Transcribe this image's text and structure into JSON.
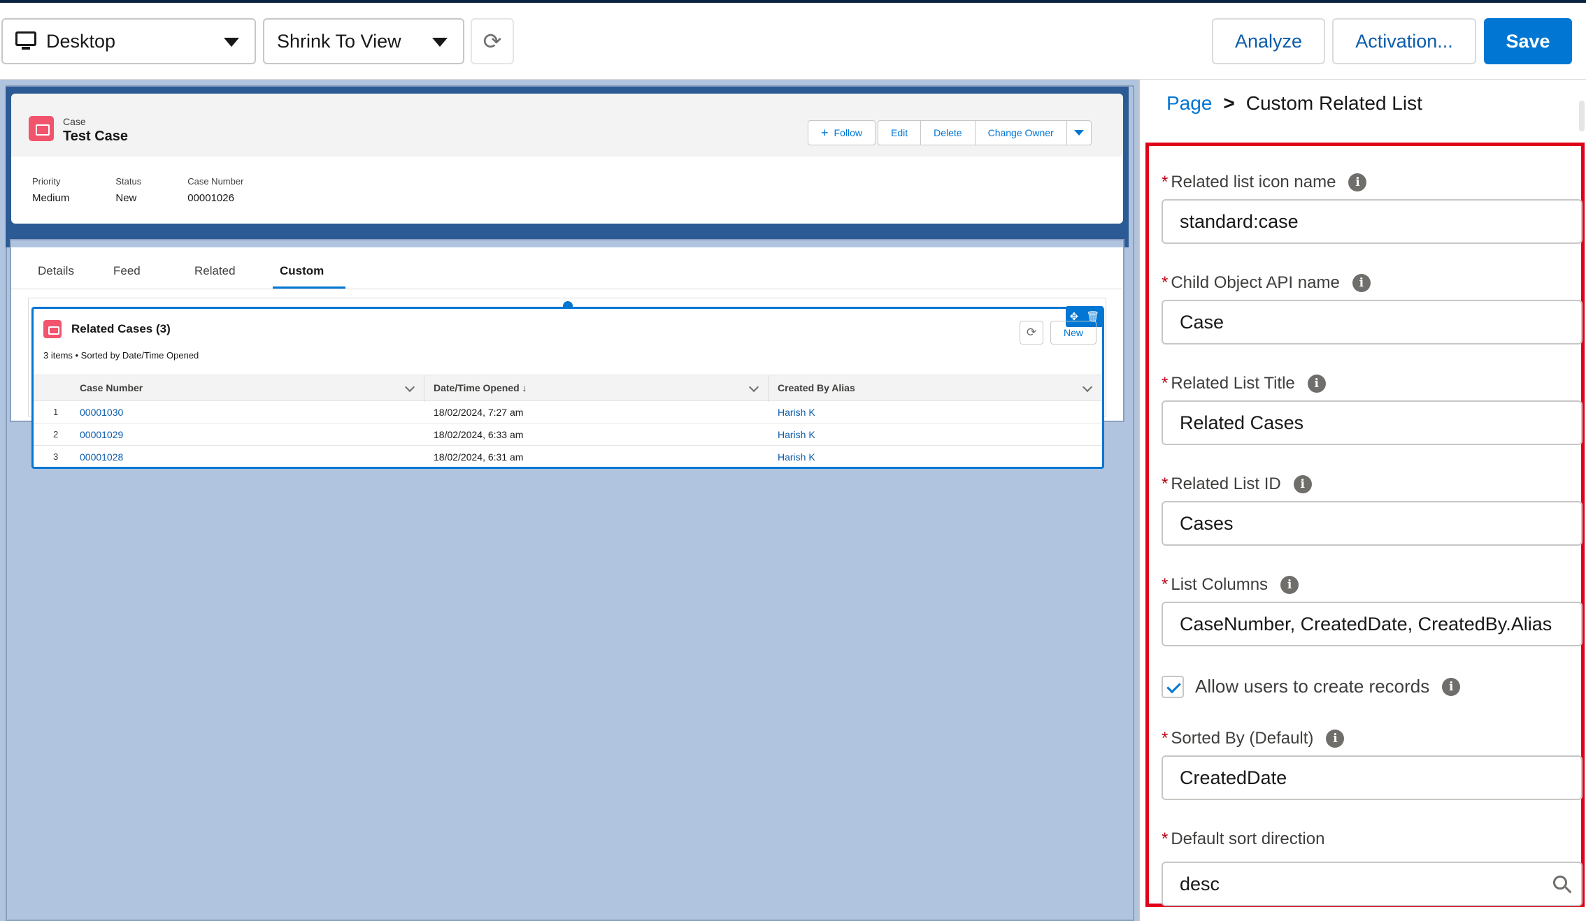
{
  "toolbar": {
    "device_label": "Desktop",
    "view_label": "Shrink To View",
    "analyze_label": "Analyze",
    "activation_label": "Activation...",
    "save_label": "Save"
  },
  "record": {
    "object_label": "Case",
    "title": "Test Case",
    "actions": {
      "follow": "Follow",
      "edit": "Edit",
      "delete": "Delete",
      "change_owner": "Change Owner"
    },
    "fields": [
      {
        "label": "Priority",
        "value": "Medium"
      },
      {
        "label": "Status",
        "value": "New"
      },
      {
        "label": "Case Number",
        "value": "00001026"
      }
    ]
  },
  "tabs": [
    "Details",
    "Feed",
    "Related",
    "Custom"
  ],
  "active_tab": "Custom",
  "related_list": {
    "title": "Related Cases (3)",
    "subtitle": "3 items • Sorted by Date/Time Opened",
    "new_label": "New",
    "columns": [
      "Case Number",
      "Date/Time Opened ↓",
      "Created By Alias"
    ],
    "rows": [
      {
        "num": "1",
        "case": "00001030",
        "opened": "18/02/2024, 7:27 am",
        "alias": "Harish K"
      },
      {
        "num": "2",
        "case": "00001029",
        "opened": "18/02/2024, 6:33 am",
        "alias": "Harish K"
      },
      {
        "num": "3",
        "case": "00001028",
        "opened": "18/02/2024, 6:31 am",
        "alias": "Harish K"
      }
    ]
  },
  "panel": {
    "breadcrumb_root": "Page",
    "breadcrumb_sep": ">",
    "breadcrumb_current": "Custom Related List",
    "icon_name_label": "Related list icon name",
    "icon_name_value": "standard:case",
    "child_object_label": "Child Object API name",
    "child_object_value": "Case",
    "list_title_label": "Related List Title",
    "list_title_value": "Related Cases",
    "list_id_label": "Related List ID",
    "list_id_value": "Cases",
    "columns_label": "List Columns",
    "columns_value": "CaseNumber, CreatedDate, CreatedBy.Alias",
    "allow_create_label": "Allow users to create records",
    "allow_create_checked": true,
    "sorted_by_label": "Sorted By (Default)",
    "sorted_by_value": "CreatedDate",
    "sort_dir_label": "Default sort direction",
    "sort_dir_value": "desc"
  },
  "colors": {
    "brand": "#0176d3",
    "canvas": "#b0c4df",
    "highlight_border": "#e0001a",
    "case_icon": "#f2536d"
  },
  "icons": [
    "desktop-icon",
    "chevron-down-icon",
    "refresh-icon",
    "case-icon",
    "add-icon",
    "move-icon",
    "delete-icon",
    "info-icon",
    "checkbox-checked-icon",
    "search-icon"
  ]
}
